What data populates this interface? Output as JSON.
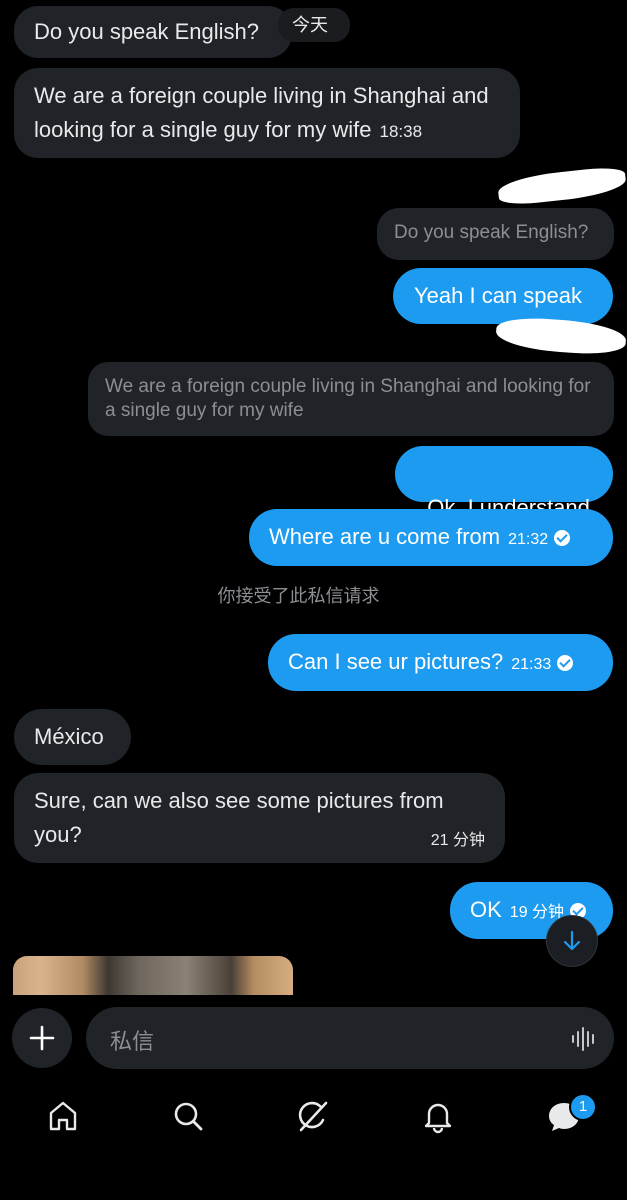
{
  "messages": {
    "m1": {
      "text": "Do you speak English?"
    },
    "day_label": "今天",
    "m2": {
      "text": "We are a foreign couple living in Shanghai and looking for a single guy for my wife",
      "time": "18:38"
    },
    "q1": {
      "text": "Do you speak English?"
    },
    "m3": {
      "text": "Yeah I can speak"
    },
    "q2": {
      "text": "We are a foreign couple living in Shanghai and looking for a single guy for my wife"
    },
    "m4": {
      "text": "Ok  I understand"
    },
    "m5": {
      "text": "Where are u come from",
      "time": "21:32"
    },
    "system": "你接受了此私信请求",
    "m6": {
      "text": "Can I see ur pictures?",
      "time": "21:33"
    },
    "m7": {
      "text": "México"
    },
    "m8": {
      "text": "Sure, can we also see some pictures from you?",
      "time": "21 分钟"
    },
    "m9": {
      "text": "OK",
      "time": "19 分钟"
    }
  },
  "composer": {
    "placeholder": "私信"
  },
  "nav": {
    "messages_badge": "1"
  },
  "colors": {
    "accent": "#1d9bf0",
    "incoming": "#202327",
    "background": "#000000"
  },
  "icons": [
    "plus-icon",
    "voice-wave-icon",
    "arrow-down-icon",
    "home-icon",
    "search-icon",
    "grok-icon",
    "bell-icon",
    "messages-icon"
  ]
}
